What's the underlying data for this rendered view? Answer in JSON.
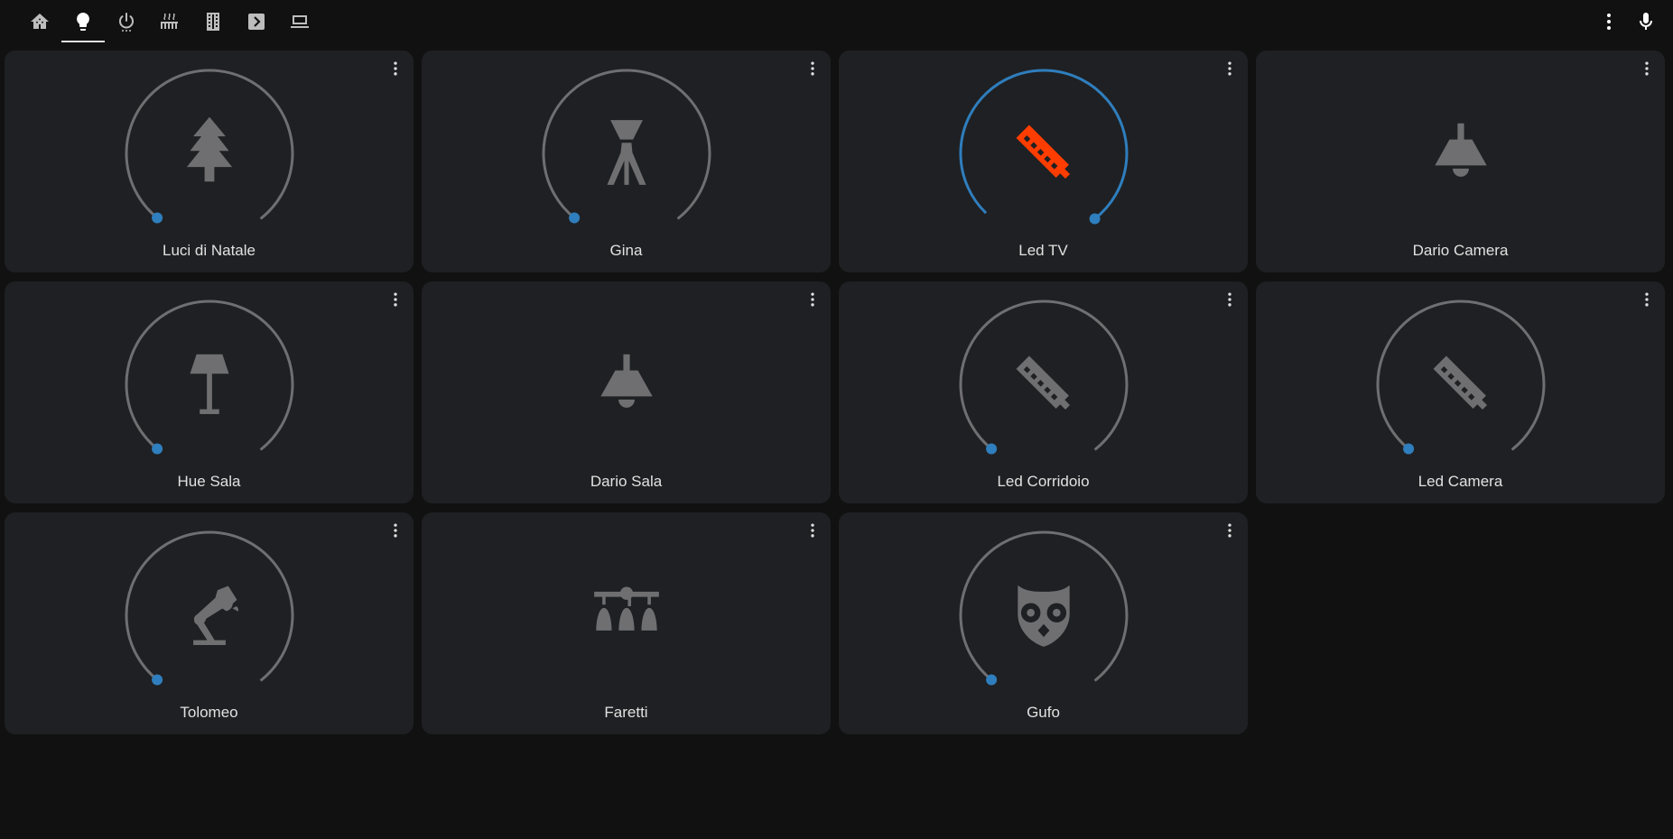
{
  "colors": {
    "background": "#111111",
    "card": "#1f2023",
    "icon_off": "#6f6f72",
    "icon_on": "#ff3d00",
    "arc_off": "#6f6f72",
    "arc_on": "#2f7ebd",
    "handle": "#2f7ebd",
    "text": "#e1e1e1",
    "toolbar_icon": "#bdbdbd",
    "toolbar_icon_active": "#ffffff"
  },
  "toolbar": {
    "tabs": [
      {
        "icon": "home-assistant-icon"
      },
      {
        "icon": "lightbulb-icon",
        "active": true
      },
      {
        "icon": "power-icon"
      },
      {
        "icon": "radiator-icon"
      },
      {
        "icon": "film-icon"
      },
      {
        "icon": "chevron-box-icon"
      },
      {
        "icon": "laptop-icon"
      }
    ],
    "right": [
      {
        "icon": "more-vertical-icon"
      },
      {
        "icon": "microphone-icon"
      }
    ]
  },
  "cards": [
    {
      "name": "Luci di Natale",
      "icon": "pine-tree-icon",
      "dial": true,
      "on": false
    },
    {
      "name": "Gina",
      "icon": "floor-lamp-tripod-icon",
      "dial": true,
      "on": false
    },
    {
      "name": "Led TV",
      "icon": "led-strip-icon",
      "dial": true,
      "on": true
    },
    {
      "name": "Dario Camera",
      "icon": "ceiling-light-icon",
      "dial": false,
      "on": false
    },
    {
      "name": "Hue Sala",
      "icon": "floor-lamp-icon",
      "dial": true,
      "on": false
    },
    {
      "name": "Dario Sala",
      "icon": "ceiling-light-icon",
      "dial": false,
      "on": false
    },
    {
      "name": "Led Corridoio",
      "icon": "led-strip-icon",
      "dial": true,
      "on": false
    },
    {
      "name": "Led Camera",
      "icon": "led-strip-icon",
      "dial": true,
      "on": false
    },
    {
      "name": "Tolomeo",
      "icon": "desk-lamp-icon",
      "dial": true,
      "on": false
    },
    {
      "name": "Faretti",
      "icon": "track-light-icon",
      "dial": false,
      "on": false
    },
    {
      "name": "Gufo",
      "icon": "owl-icon",
      "dial": true,
      "on": false
    }
  ]
}
